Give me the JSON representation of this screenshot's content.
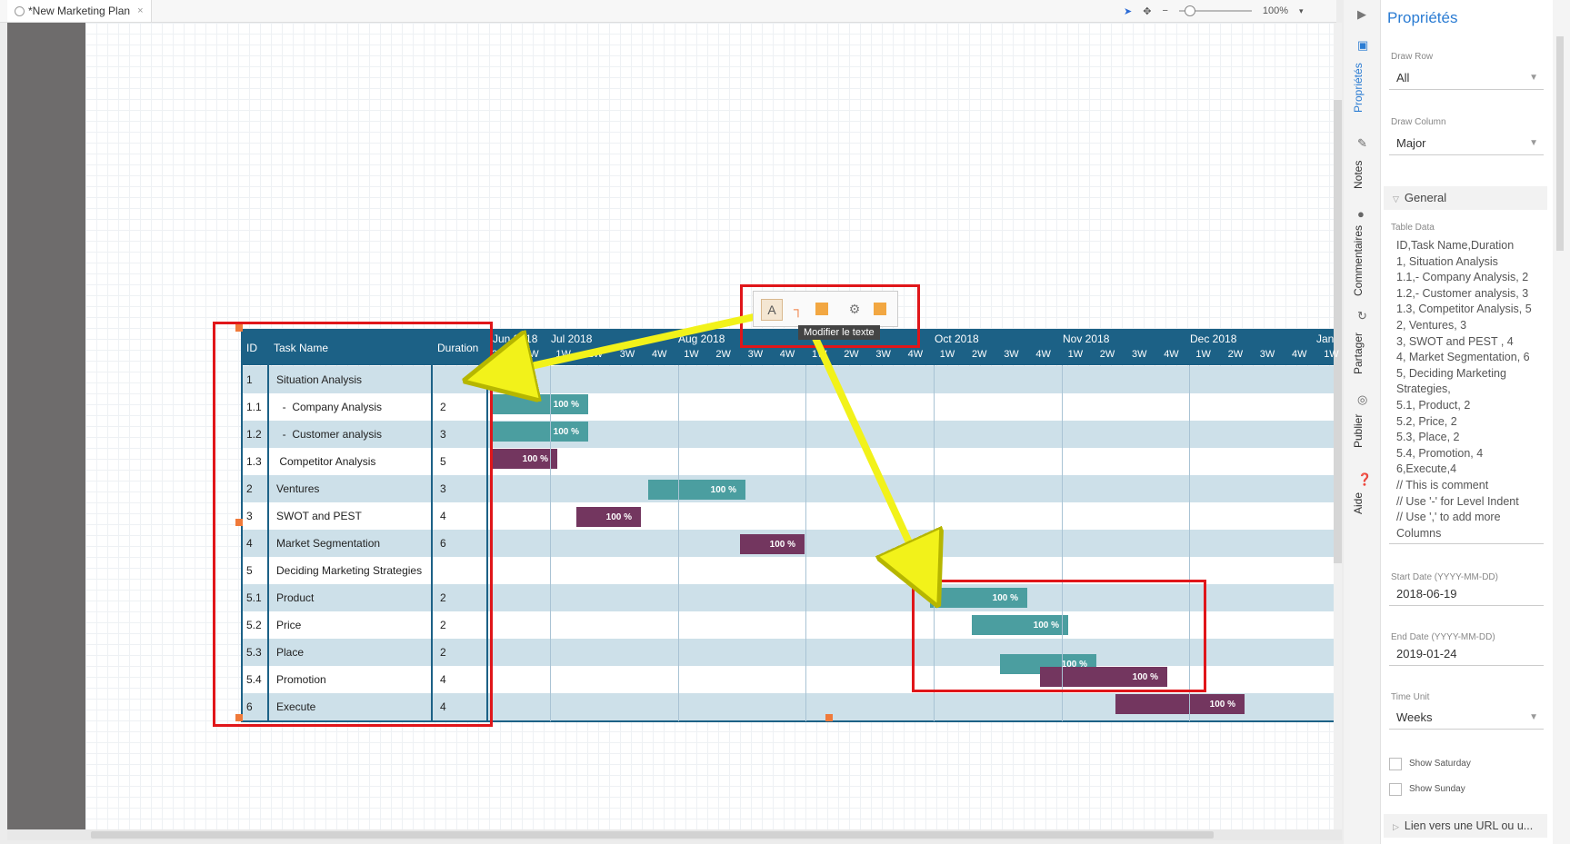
{
  "tab": {
    "title": "*New Marketing Plan",
    "close": "×"
  },
  "toolbar": {
    "zoom": "100%"
  },
  "gantt": {
    "headers": {
      "id": "ID",
      "task": "Task Name",
      "duration": "Duration"
    },
    "months": [
      "Jun 2018",
      "Jul 2018",
      "Aug 2018",
      "Oct 2018",
      "Nov 2018",
      "Dec 2018",
      "Jan"
    ],
    "weeks": [
      "3W",
      "4W",
      "1W",
      "2W",
      "3W",
      "4W",
      "1W",
      "2W",
      "3W",
      "4W",
      "1W",
      "2W",
      "3W",
      "4W",
      "1W",
      "2W",
      "3W",
      "4W",
      "1W",
      "2W",
      "3W",
      "4W",
      "1W",
      "2W",
      "3W",
      "4W",
      "1W"
    ],
    "rows": [
      {
        "id": "1",
        "task": "Situation Analysis",
        "duration": ""
      },
      {
        "id": "1.1",
        "task": "  -  Company Analysis",
        "duration": "2"
      },
      {
        "id": "1.2",
        "task": "  -  Customer analysis",
        "duration": "3"
      },
      {
        "id": "1.3",
        "task": " Competitor Analysis",
        "duration": "5"
      },
      {
        "id": "2",
        "task": "Ventures",
        "duration": "3"
      },
      {
        "id": "3",
        "task": "SWOT and PEST",
        "duration": "4"
      },
      {
        "id": "4",
        "task": "Market Segmentation",
        "duration": "6"
      },
      {
        "id": "5",
        "task": "Deciding Marketing Strategies",
        "duration": ""
      },
      {
        "id": "5.1",
        "task": "Product",
        "duration": "2"
      },
      {
        "id": "5.2",
        "task": "Price",
        "duration": "2"
      },
      {
        "id": "5.3",
        "task": "Place",
        "duration": "2"
      },
      {
        "id": "5.4",
        "task": "Promotion",
        "duration": "4"
      },
      {
        "id": "6",
        "task": "Execute",
        "duration": "4"
      }
    ],
    "bars": [
      {
        "label": "100 %",
        "color": "#4b9ea0",
        "progress": 100
      },
      {
        "label": "100 %",
        "color": "#4b9ea0",
        "progress": 100
      },
      {
        "label": "100 %",
        "color": "#73365f",
        "progress": 100
      },
      {
        "label": "100 %",
        "color": "#4b9ea0",
        "progress": 100
      },
      {
        "label": "100 %",
        "color": "#73365f",
        "progress": 100
      },
      {
        "label": "100 %",
        "color": "#73365f",
        "progress": 100
      },
      {
        "label": "100 %",
        "color": "#4b9ea0",
        "progress": 100
      },
      {
        "label": "100 %",
        "color": "#4b9ea0",
        "progress": 100
      },
      {
        "label": "100 %",
        "color": "#4b9ea0",
        "progress": 100
      },
      {
        "label": "100 %",
        "color": "#73365f",
        "progress": 100
      },
      {
        "label": "100 %",
        "color": "#73365f",
        "progress": 100
      }
    ]
  },
  "floating_toolbar": {
    "text_button": "A",
    "tooltip": "Modifier le texte"
  },
  "side_tabs": [
    "Propriétés",
    "Notes",
    "Commentaires",
    "Partager",
    "Publier",
    "Aide"
  ],
  "panel": {
    "title": "Propriétés",
    "draw_row": {
      "label": "Draw Row",
      "value": "All"
    },
    "draw_column": {
      "label": "Draw Column",
      "value": "Major"
    },
    "general": "General",
    "table_data": {
      "label": "Table Data",
      "lines": [
        "ID,Task Name,Duration",
        "1, Situation Analysis",
        "1.1,- Company Analysis, 2",
        "1.2,- Customer analysis, 3",
        "1.3,  Competitor Analysis, 5",
        "2, Ventures, 3",
        "3, SWOT and PEST , 4",
        "4, Market Segmentation, 6",
        "5, Deciding Marketing",
        "Strategies,",
        "5.1, Product, 2",
        "5.2, Price, 2",
        "5.3, Place, 2",
        "5.4, Promotion, 4",
        "6,Execute,4",
        "// This is comment",
        "// Use '-' for Level Indent",
        "// Use ',' to add more",
        "Columns"
      ]
    },
    "start_date": {
      "label": "Start Date (YYYY-MM-DD)",
      "value": "2018-06-19"
    },
    "end_date": {
      "label": "End Date (YYYY-MM-DD)",
      "value": "2019-01-24"
    },
    "time_unit": {
      "label": "Time Unit",
      "value": "Weeks"
    },
    "show_saturday": "Show Saturday",
    "show_sunday": "Show Sunday",
    "link": "Lien vers une URL ou u..."
  },
  "colors": {
    "header": "#1c6186",
    "accent": "#e0161a",
    "arrow": "#f2f21a"
  }
}
